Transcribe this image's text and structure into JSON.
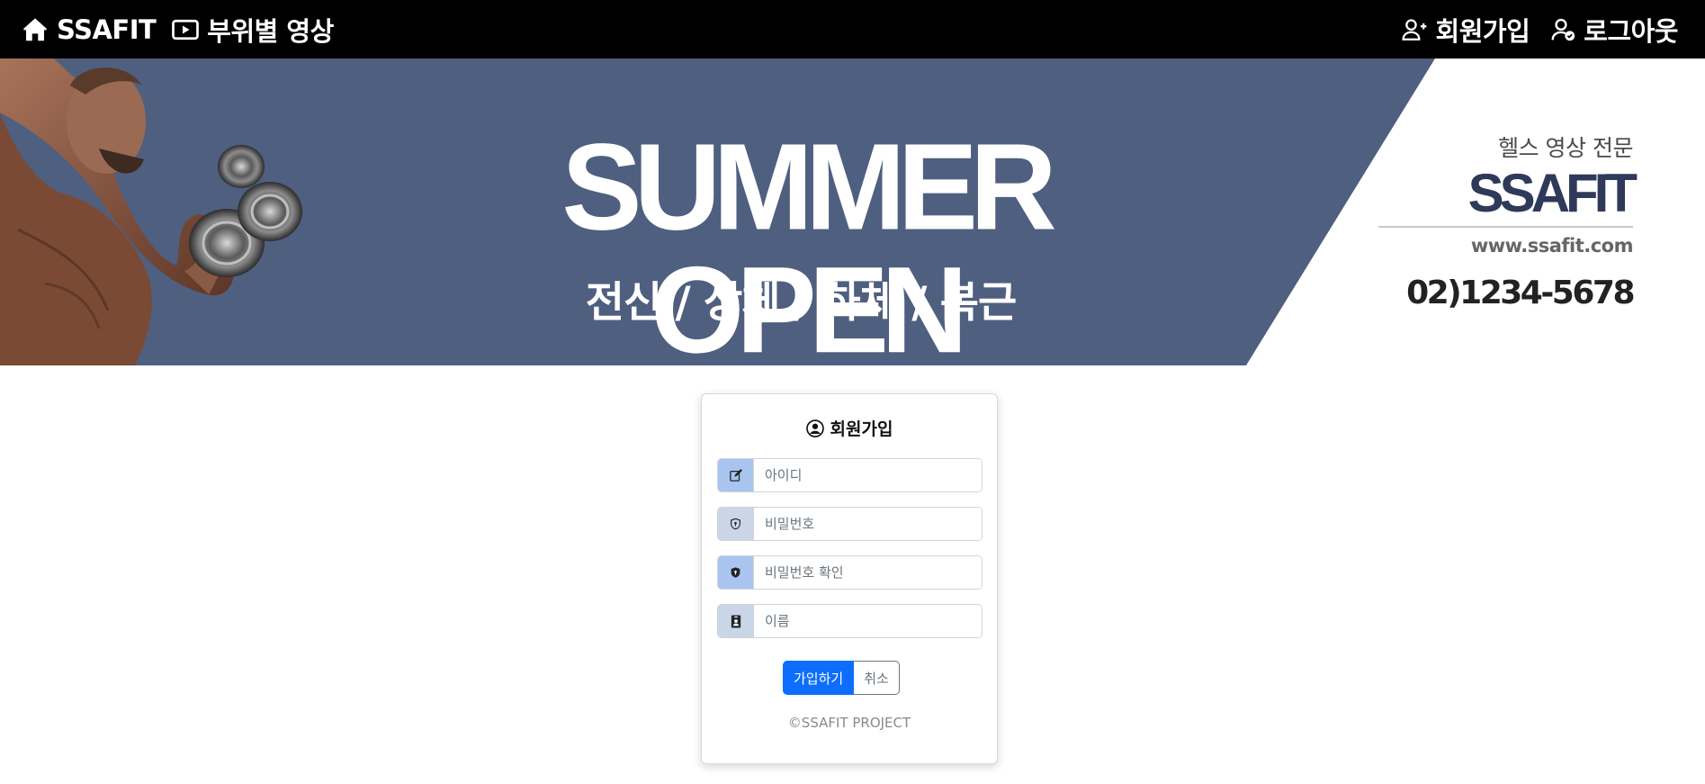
{
  "navbar": {
    "home_label": "SSAFIT",
    "videos_label": "부위별 영상",
    "signup_label": "회원가입",
    "logout_label": "로그아웃",
    "icons": [
      "house-icon",
      "play-video-icon",
      "person-plus-icon",
      "person-check-icon"
    ]
  },
  "banner": {
    "title": "SUMMER OPEN",
    "subtitle": "전신 / 상체 / 하체 / 복근",
    "tagline": "헬스 영상 전문",
    "brand": "SSAFIT",
    "url": "www.ssafit.com",
    "phone": "02)1234-5678",
    "colors": {
      "panel": "#4f5f7f",
      "brand": "#2f3a5a"
    }
  },
  "signup_form": {
    "title": "회원가입",
    "fields": [
      {
        "icon": "pencil-square-icon",
        "placeholder": "아이디",
        "value": "",
        "addon_color": "#a9c5ef"
      },
      {
        "icon": "shield-icon",
        "placeholder": "비밀번호",
        "value": "",
        "addon_color": "#cad6e8"
      },
      {
        "icon": "shield-fill-icon",
        "placeholder": "비밀번호 확인",
        "value": "",
        "addon_color": "#a9c5ef"
      },
      {
        "icon": "person-badge-icon",
        "placeholder": "이름",
        "value": "",
        "addon_color": "#cad6e8"
      }
    ],
    "submit_label": "가입하기",
    "cancel_label": "취소",
    "footer": "©SSAFIT PROJECT",
    "colors": {
      "primary": "#0d6efd",
      "secondary": "#6c757d"
    }
  }
}
